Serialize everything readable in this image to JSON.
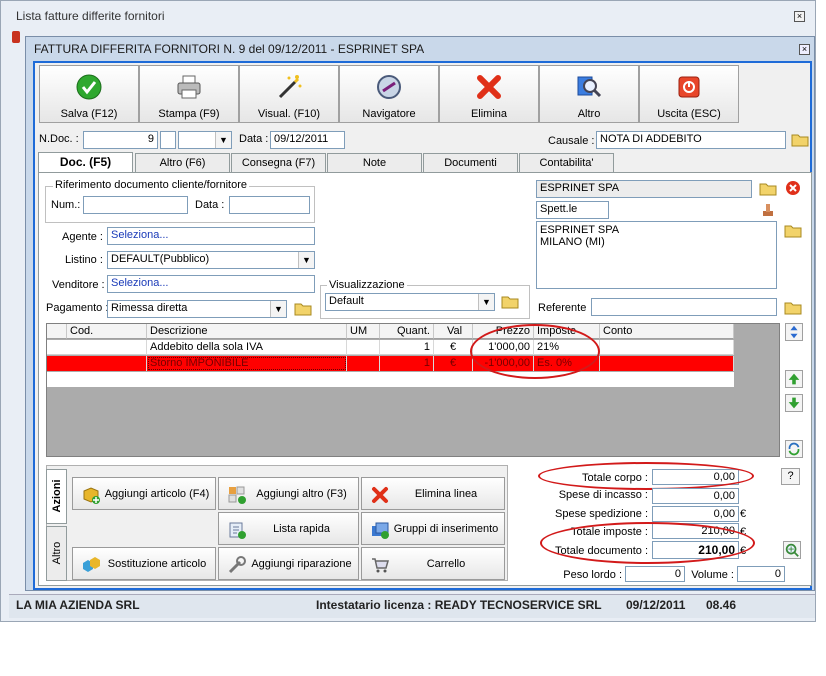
{
  "bg_window": {
    "title": "Lista fatture differite fornitori",
    "footer": [
      "LA MIA AZIENDA SRL",
      "Intestatario licenza : READY TECNOSERVICE SRL",
      "09/12/2011",
      "08.46"
    ]
  },
  "dialog": {
    "title": "FATTURA DIFFERITA FORNITORI N. 9  del 09/12/2011 - ESPRINET SPA"
  },
  "toolbar": [
    {
      "label": "Salva (F12)",
      "icon": "check-icon"
    },
    {
      "label": "Stampa (F9)",
      "icon": "printer-icon"
    },
    {
      "label": "Visual. (F10)",
      "icon": "magic-wand-icon"
    },
    {
      "label": "Navigatore",
      "icon": "compass-icon"
    },
    {
      "label": "Elimina",
      "icon": "red-x-icon"
    },
    {
      "label": "Altro",
      "icon": "magnifier-icon"
    },
    {
      "label": "Uscita (ESC)",
      "icon": "exit-icon"
    }
  ],
  "header": {
    "ndoc_label": "N.Doc. :",
    "ndoc_value": "9",
    "data_label": "Data :",
    "data_value": "09/12/2011",
    "causale_label": "Causale :",
    "causale_value": "NOTA DI ADDEBITO"
  },
  "tabs": [
    "Doc. (F5)",
    "Altro (F6)",
    "Consegna (F7)",
    "Note",
    "Documenti",
    "Contabilita'"
  ],
  "doc": {
    "rif_title": "Riferimento documento cliente/fornitore",
    "num_label": "Num.:",
    "num_value": "",
    "data_label": "Data :",
    "data_value": "",
    "agente_label": "Agente :",
    "agente_value": "Seleziona...",
    "listino_label": "Listino :",
    "listino_value": "DEFAULT(Pubblico)",
    "venditore_label": "Venditore :",
    "venditore_value": "Seleziona...",
    "pagamento_label": "Pagamento :",
    "pagamento_value": "Rimessa diretta",
    "visualizzazione_label": "Visualizzazione",
    "visualizzazione_value": "Default",
    "fornitore_name": "ESPRINET SPA",
    "spett": "Spett.le",
    "address_lines": [
      "ESPRINET SPA",
      "MILANO (MI)"
    ],
    "referente_label": "Referente",
    "referente_value": ""
  },
  "grid": {
    "columns": [
      "Cod.",
      "Descrizione",
      "UM",
      "Quant.",
      "Val",
      "Prezzo",
      "Imposte",
      "Conto"
    ],
    "rows": [
      {
        "cod": "",
        "desc": "Addebito della sola IVA",
        "um": "",
        "quant": "1",
        "val": "€",
        "prezzo": "1'000,00",
        "imposte": "21%",
        "conto": "",
        "highlight": false
      },
      {
        "cod": "",
        "desc": "Storno IMPONIBILE",
        "um": "",
        "quant": "1",
        "val": "€",
        "prezzo": "-1'000,00",
        "imposte": "Es. 0%",
        "conto": "",
        "highlight": true
      }
    ]
  },
  "side_tabs": [
    "Azioni",
    "Altro"
  ],
  "actions": [
    {
      "label": "Aggiungi articolo (F4)",
      "icon": "add-article-icon"
    },
    {
      "label": "Aggiungi altro (F3)",
      "icon": "add-other-icon"
    },
    {
      "label": "Elimina linea",
      "icon": "delete-line-icon"
    },
    {
      "label": "Lista rapida",
      "icon": "quick-list-icon"
    },
    {
      "label": "Gruppi di inserimento",
      "icon": "insert-groups-icon"
    },
    {
      "label": "Sostituzione articolo",
      "icon": "replace-article-icon"
    },
    {
      "label": "Aggiungi riparazione",
      "icon": "repair-icon"
    },
    {
      "label": "Carrello",
      "icon": "cart-icon"
    }
  ],
  "totals": {
    "corpo_label": "Totale corpo :",
    "corpo": "0,00",
    "incasso_label": "Spese di incasso :",
    "incasso": "0,00",
    "spedizione_label": "Spese spedizione :",
    "spedizione": "0,00",
    "imposte_label": "Totale imposte :",
    "imposte": "210,00",
    "documento_label": "Totale documento :",
    "documento": "210,00",
    "currency": "€",
    "peso_label": "Peso lordo :",
    "peso": "0",
    "volume_label": "Volume :",
    "volume": "0",
    "help": "?"
  },
  "colors": {
    "accent": "#1e6bd8",
    "row_highlight": "#ff0000",
    "annotation": "#d21a1a"
  }
}
